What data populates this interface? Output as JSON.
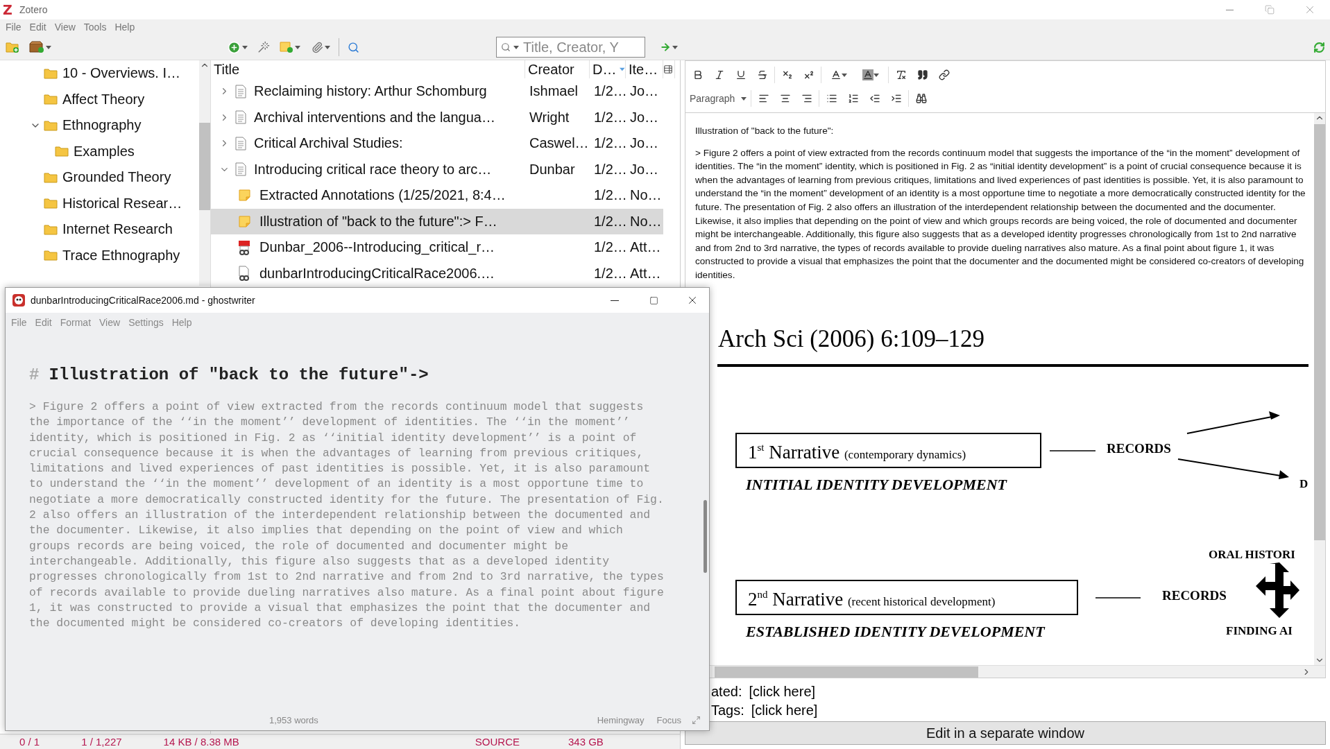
{
  "app_window": {
    "logo": "Z",
    "title": "Zotero"
  },
  "menu": [
    {
      "label": "File"
    },
    {
      "label": "Edit"
    },
    {
      "label": "View"
    },
    {
      "label": "Tools"
    },
    {
      "label": "Help"
    }
  ],
  "search": {
    "placeholder": "Title, Creator, Y"
  },
  "collections": [
    {
      "label": "10 - Overviews. I…"
    },
    {
      "label": "Affect Theory"
    },
    {
      "label": "Ethnography",
      "expanded": true,
      "children": [
        {
          "label": "Examples"
        }
      ]
    },
    {
      "label": "Grounded Theory"
    },
    {
      "label": "Historical Resear…"
    },
    {
      "label": "Internet Research"
    },
    {
      "label": "Trace Ethnography"
    }
  ],
  "items_table": {
    "columns": [
      {
        "label": "Title",
        "sorted": false
      },
      {
        "label": "Creator",
        "sorted": false
      },
      {
        "label": "D…",
        "sorted": true
      },
      {
        "label": "Ite…",
        "sorted": false
      }
    ],
    "rows": [
      {
        "kind": "item",
        "title": "Reclaiming history: Arthur Schomburg",
        "creator": "Ishmael",
        "date": "1/2…",
        "type": "Jo…",
        "expanded": false,
        "selected": false
      },
      {
        "kind": "item",
        "title": "Archival interventions and the langua…",
        "creator": "Wright",
        "date": "1/2…",
        "type": "Jo…",
        "expanded": false,
        "selected": false
      },
      {
        "kind": "item",
        "title": "Critical Archival Studies:",
        "creator": "Caswel…",
        "date": "1/2…",
        "type": "Jo…",
        "expanded": false,
        "selected": false
      },
      {
        "kind": "item",
        "title": "Introducing critical race theory to arc…",
        "creator": "Dunbar",
        "date": "1/2…",
        "type": "Jo…",
        "expanded": true,
        "selected": false,
        "children": [
          {
            "kind": "note",
            "title": "Extracted Annotations (1/25/2021, 8:4…",
            "date": "1/2…",
            "type": "No…",
            "selected": false
          },
          {
            "kind": "note",
            "title": "Illustration of \"back to the future\":> F…",
            "date": "1/2…",
            "type": "No…",
            "selected": true
          },
          {
            "kind": "pdf",
            "title": "Dunbar_2006--Introducing_critical_r…",
            "date": "1/2…",
            "type": "Att…",
            "selected": false
          },
          {
            "kind": "linked-file",
            "title": "dunbarIntroducingCriticalRace2006.…",
            "date": "1/2…",
            "type": "Att…",
            "selected": false
          }
        ]
      }
    ]
  },
  "note_editor": {
    "format_select": "Paragraph",
    "title_line": "Illustration of \"back to the future\":",
    "paragraph": "> Figure 2 offers a point of view extracted from the records continuum model that suggests the importance of the “in the moment” development of identities. The “in the moment” identity, which is positioned in Fig. 2 as “initial identity development” is a point of crucial consequence because it is when the advantages of learning from previous critiques, limitations and lived experiences of past identities is possible. Yet, it is also paramount to understand the “in the moment” development of an identity is a most opportune time to negotiate a more democratically constructed identity for the future. The presentation of Fig. 2 also offers an illustration of the interdependent relationship between the documented and the documenter. Likewise, it also implies that depending on the point of view and which groups records are being voiced, the role of documented and documenter might be interchangeable. Additionally, this figure also suggests that as a developed identity progresses chronologically from 1st to 2nd narrative and from 2nd to 3rd narrative, the types of records available to provide dueling narratives also mature. As a final point about figure 1, it was constructed to provide a visual that emphasizes the point that the documenter and the documented might be considered co-creators of developing identities.",
    "figure": {
      "journal_header": "Arch Sci (2006) 6:109–129",
      "narratives": [
        {
          "ordinal": "1",
          "suffix": "st",
          "name": "Narrative",
          "note": "(contemporary dynamics)",
          "stage": "INTITIAL IDENTITY DEVELOPMENT",
          "records": "RECORDS"
        },
        {
          "ordinal": "2",
          "suffix": "nd",
          "name": "Narrative",
          "note": "(recent historical development)",
          "stage": "ESTABLISHED IDENTITY DEVELOPMENT",
          "records": "RECORDS"
        }
      ],
      "cut_labels": [
        "D",
        "ORAL HISTORI",
        "FINDING AI"
      ]
    }
  },
  "relations": [
    {
      "label": "ated:",
      "value": "[click here]"
    },
    {
      "label": "Tags:",
      "value": "[click here]"
    }
  ],
  "edit_button": "Edit in a separate window",
  "status_bar": [
    "0 / 1",
    "1 / 1,227",
    "14 KB / 8.38 MB",
    "SOURCE",
    "343 GB"
  ],
  "ghostwriter": {
    "title": "dunbarIntroducingCriticalRace2006.md - ghostwriter",
    "menu": [
      {
        "label": "File"
      },
      {
        "label": "Edit"
      },
      {
        "label": "Format"
      },
      {
        "label": "View"
      },
      {
        "label": "Settings"
      },
      {
        "label": "Help"
      }
    ],
    "heading_marker": "#",
    "heading": "Illustration of \"back to the future\"->",
    "paragraph": "> Figure 2 offers a point of view extracted from the records continuum model that suggests the importance of the ‘‘in the moment’’ development of identities. The ‘‘in the moment’’ identity, which is positioned in Fig. 2 as ‘‘initial identity development’’ is a point of crucial consequence because it is when the advantages of learning from previous critiques, limitations and lived experiences of past identities is possible. Yet, it is also paramount to understand the ‘‘in the moment’’ development of an identity is a most opportune time to negotiate a more democratically constructed identity for the future. The presentation of Fig. 2 also offers an illustration of the interdependent relationship between the documented and the documenter. Likewise, it also implies that depending on the point of view and which groups records are being voiced, the role of documented and documenter might be interchangeable. Additionally, this figure also suggests that as a developed identity progresses chronologically from 1st to 2nd narrative and from 2nd to 3rd narrative, the types of records available to provide dueling narratives also mature. As a final point about figure 1, it was constructed to provide a visual that emphasizes the point that the documenter and the documented might be considered co-creators of developing identities.",
    "word_count": "1,953 words",
    "footer_buttons": [
      "Hemingway",
      "Focus"
    ]
  }
}
